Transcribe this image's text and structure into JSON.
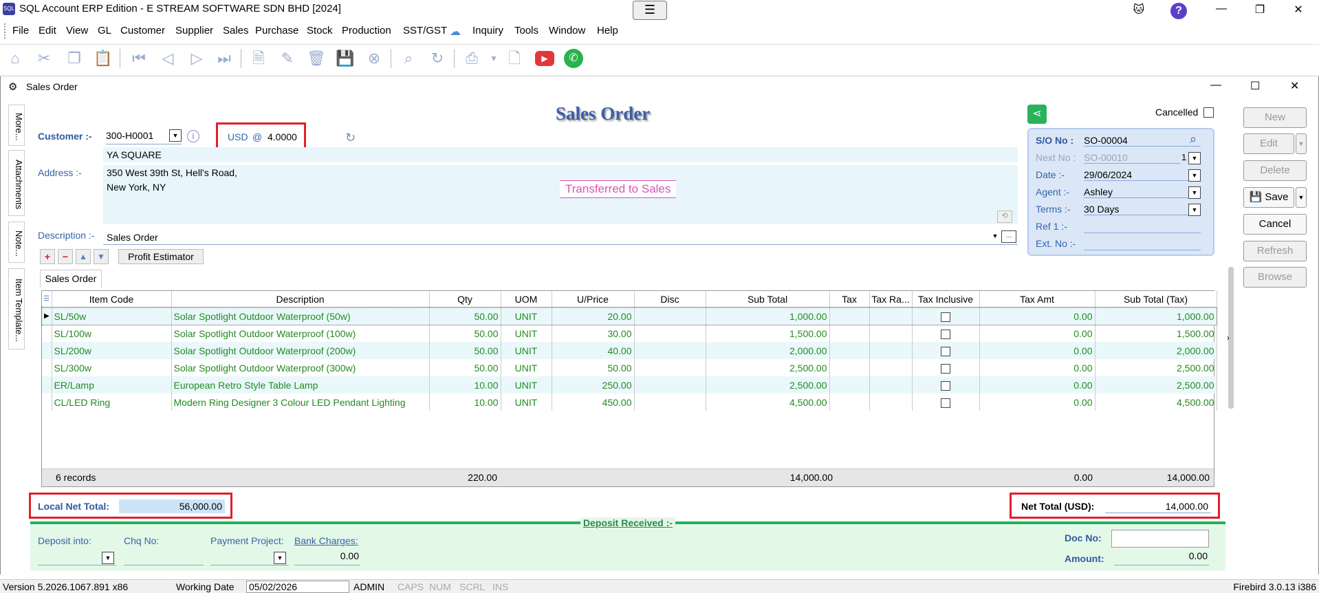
{
  "app": {
    "title": "SQL Account ERP Edition - E STREAM SOFTWARE SDN BHD [2024]",
    "logo_text": "SQL"
  },
  "menu": [
    "File",
    "Edit",
    "View",
    "GL",
    "Customer",
    "Supplier",
    "Sales",
    "Purchase",
    "Stock",
    "Production",
    "SST/GST",
    "Inquiry",
    "Tools",
    "Window",
    "Help"
  ],
  "window": {
    "title": "Sales Order"
  },
  "side_tabs": [
    "More...",
    "Attachments",
    "Note...",
    "Item Template..."
  ],
  "form": {
    "heading": "Sales Order",
    "customer_label": "Customer :-",
    "customer_code": "300-H0001",
    "currency": "USD",
    "currency_at": "@",
    "currency_rate": "4.0000",
    "customer_name": "YA SQUARE",
    "address_label": "Address :-",
    "address_line1": "350 West 39th St, Hell's Road,",
    "address_line2": "New York, NY",
    "transferred_text": "Transferred to Sales",
    "description_label": "Description :-",
    "description_value": "Sales Order",
    "profit_estimator": "Profit Estimator",
    "tab_label": "Sales Order",
    "cancelled_label": "Cancelled"
  },
  "so_panel": {
    "so_no_label": "S/O No :",
    "so_no_value": "SO-00004",
    "next_no_label": "Next No :",
    "next_no_value": "SO-00010",
    "next_no_count": "1",
    "date_label": "Date :-",
    "date_value": "29/06/2024",
    "agent_label": "Agent :-",
    "agent_value": "Ashley",
    "terms_label": "Terms :-",
    "terms_value": "30 Days",
    "ref1_label": "Ref 1 :-",
    "extno_label": "Ext. No :-"
  },
  "right_buttons": {
    "new": "New",
    "edit": "Edit",
    "delete": "Delete",
    "save": "Save",
    "cancel": "Cancel",
    "refresh": "Refresh",
    "browse": "Browse"
  },
  "grid": {
    "columns": [
      "Item Code",
      "Description",
      "Qty",
      "UOM",
      "U/Price",
      "Disc",
      "Sub Total",
      "Tax",
      "Tax Ra...",
      "Tax Inclusive",
      "Tax Amt",
      "Sub Total (Tax)"
    ],
    "rows": [
      {
        "code": "SL/50w",
        "desc": "Solar Spotlight Outdoor Waterproof (50w)",
        "qty": "50.00",
        "uom": "UNIT",
        "price": "20.00",
        "subtotal": "1,000.00",
        "taxamt": "0.00",
        "subtax": "1,000.00"
      },
      {
        "code": "SL/100w",
        "desc": "Solar Spotlight Outdoor Waterproof (100w)",
        "qty": "50.00",
        "uom": "UNIT",
        "price": "30.00",
        "subtotal": "1,500.00",
        "taxamt": "0.00",
        "subtax": "1,500.00"
      },
      {
        "code": "SL/200w",
        "desc": "Solar Spotlight Outdoor Waterproof (200w)",
        "qty": "50.00",
        "uom": "UNIT",
        "price": "40.00",
        "subtotal": "2,000.00",
        "taxamt": "0.00",
        "subtax": "2,000.00"
      },
      {
        "code": "SL/300w",
        "desc": "Solar Spotlight Outdoor Waterproof (300w)",
        "qty": "50.00",
        "uom": "UNIT",
        "price": "50.00",
        "subtotal": "2,500.00",
        "taxamt": "0.00",
        "subtax": "2,500.00"
      },
      {
        "code": "ER/Lamp",
        "desc": "European Retro Style Table Lamp",
        "qty": "10.00",
        "uom": "UNIT",
        "price": "250.00",
        "subtotal": "2,500.00",
        "taxamt": "0.00",
        "subtax": "2,500.00"
      },
      {
        "code": "CL/LED Ring",
        "desc": "Modern Ring Designer 3 Colour LED Pendant Lighting",
        "qty": "10.00",
        "uom": "UNIT",
        "price": "450.00",
        "subtotal": "4,500.00",
        "taxamt": "0.00",
        "subtax": "4,500.00"
      }
    ],
    "footer": {
      "records": "6 records",
      "qty": "220.00",
      "subtotal": "14,000.00",
      "taxamt": "0.00",
      "subtax": "14,000.00"
    }
  },
  "totals": {
    "local_label": "Local Net Total:",
    "local_value": "56,000.00",
    "net_label": "Net Total (USD):",
    "net_value": "14,000.00"
  },
  "deposit": {
    "title": "Deposit Received :-",
    "deposit_into": "Deposit into:",
    "chq_no": "Chq No:",
    "payment_project": "Payment Project:",
    "bank_charges": "Bank Charges:",
    "bank_charges_value": "0.00",
    "doc_no": "Doc No:",
    "amount": "Amount:",
    "amount_value": "0.00"
  },
  "status": {
    "version": "Version 5.2026.1067.891 x86",
    "working_date_label": "Working Date",
    "working_date": "05/02/2026",
    "user": "ADMIN",
    "caps": "CAPS",
    "num": "NUM",
    "scrl": "SCRL",
    "ins": "INS",
    "db": "Firebird 3.0.13 i386"
  },
  "colors": {
    "red_highlight": "#e0202a",
    "label_blue": "#3464a8",
    "grid_text": "#228a22",
    "deposit_green": "#1fb35a"
  }
}
